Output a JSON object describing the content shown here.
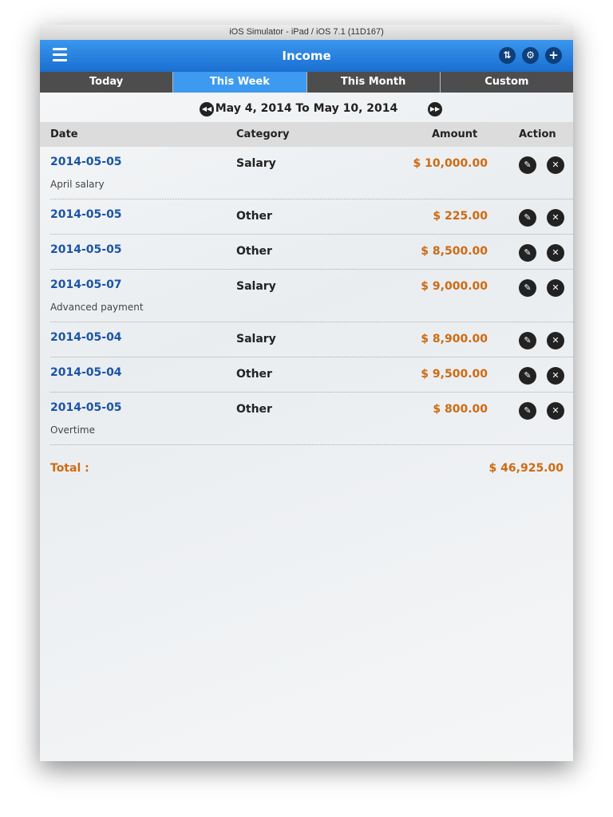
{
  "window_title": "iOS Simulator - iPad / iOS 7.1 (11D167)",
  "header": {
    "title": "Income"
  },
  "tabs": [
    {
      "label": "Today"
    },
    {
      "label": "This Week"
    },
    {
      "label": "This Month"
    },
    {
      "label": "Custom"
    }
  ],
  "active_tab": "This Week",
  "date_range": "May 4, 2014 To May 10, 2014",
  "columns": {
    "date": "Date",
    "category": "Category",
    "amount": "Amount",
    "action": "Action"
  },
  "rows": [
    {
      "date": "2014-05-05",
      "note": "April salary",
      "category": "Salary",
      "amount": "$ 10,000.00"
    },
    {
      "date": "2014-05-05",
      "note": "",
      "category": "Other",
      "amount": "$ 225.00"
    },
    {
      "date": "2014-05-05",
      "note": "",
      "category": "Other",
      "amount": "$ 8,500.00"
    },
    {
      "date": "2014-05-07",
      "note": "Advanced payment",
      "category": "Salary",
      "amount": "$ 9,000.00"
    },
    {
      "date": "2014-05-04",
      "note": "",
      "category": "Salary",
      "amount": "$ 8,900.00"
    },
    {
      "date": "2014-05-04",
      "note": "",
      "category": "Other",
      "amount": "$ 9,500.00"
    },
    {
      "date": "2014-05-05",
      "note": "Overtime",
      "category": "Other",
      "amount": "$ 800.00"
    }
  ],
  "total": {
    "label": "Total :",
    "value": "$ 46,925.00"
  },
  "colors": {
    "accent": "#1a6fd0",
    "amount": "#cf6a12",
    "date": "#1b54a6"
  }
}
